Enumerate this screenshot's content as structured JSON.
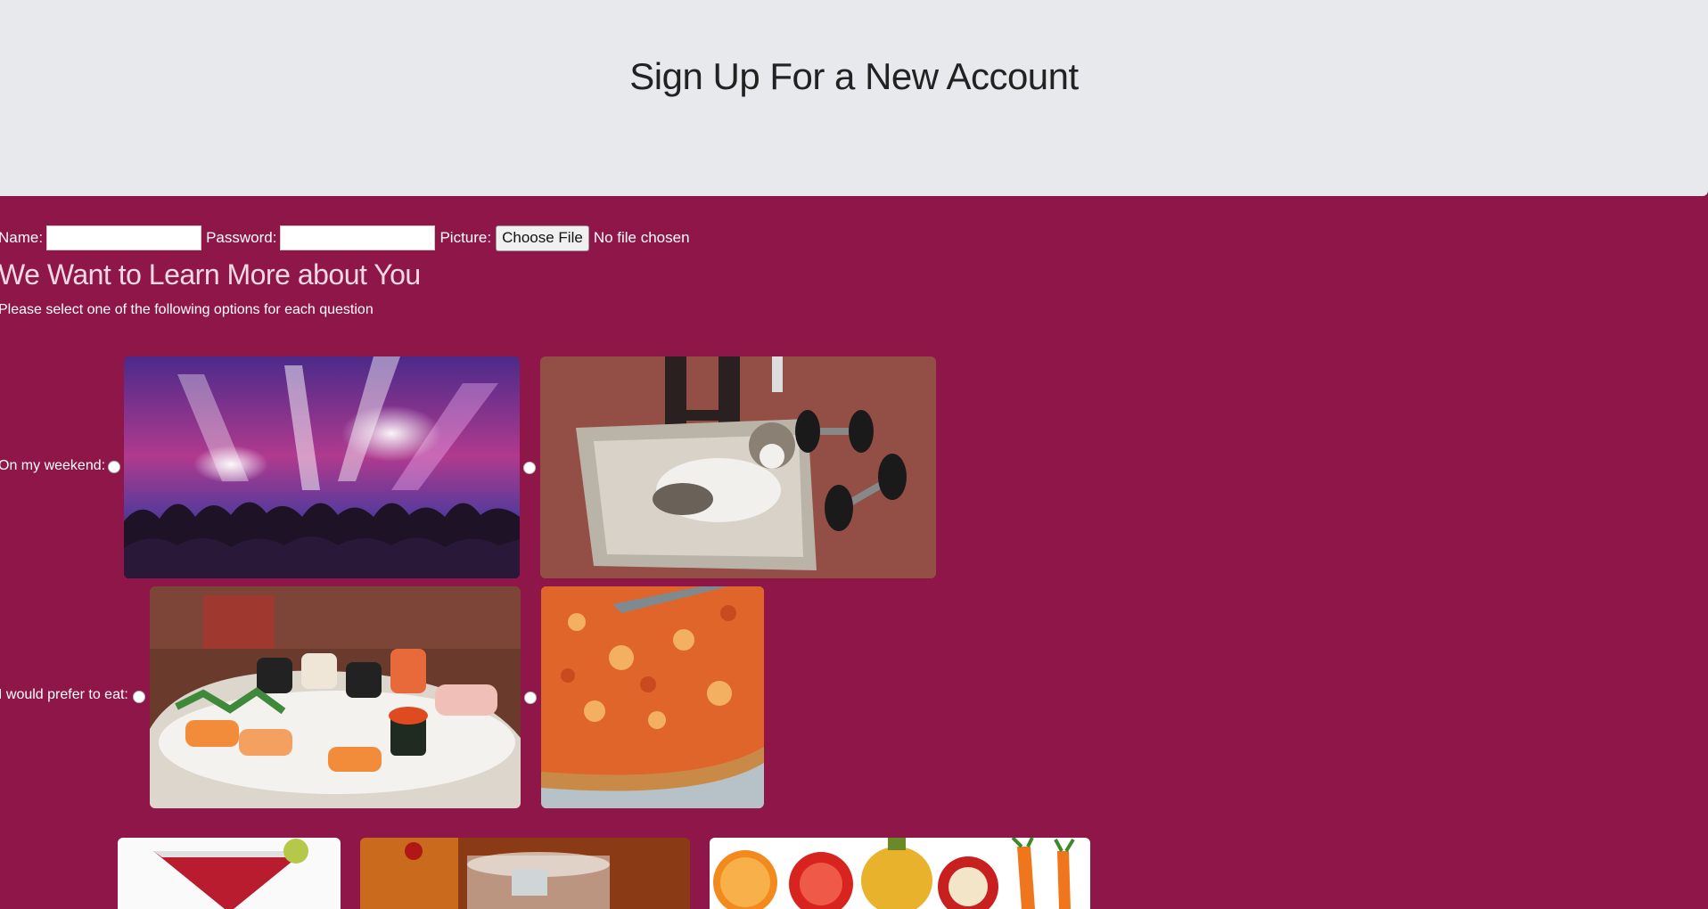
{
  "header": {
    "title": "Sign Up For a New Account"
  },
  "form": {
    "name_label": "Name:",
    "name_value": "",
    "password_label": "Password:",
    "password_value": "",
    "picture_label": "Picture:",
    "choose_file_label": "Choose File",
    "no_file_text": "No file chosen"
  },
  "survey": {
    "heading": "We Want to Learn More about You",
    "instructions": "Please select one of the following options for each question",
    "questions": [
      {
        "label": "On my weekend:",
        "options": [
          {
            "image": "concert-crowd-photo"
          },
          {
            "image": "cat-in-basket-with-dumbbells-photo"
          }
        ]
      },
      {
        "label": "I would prefer to eat:",
        "options": [
          {
            "image": "sushi-platter-photo"
          },
          {
            "image": "pizza-photo"
          }
        ]
      },
      {
        "label": "",
        "options": [
          {
            "image": "cocktail-photo"
          },
          {
            "image": "whiskey-glasses-photo"
          },
          {
            "image": "fruits-vegetables-photo"
          }
        ]
      }
    ]
  },
  "colors": {
    "page_bg": "#8e1648",
    "header_bg": "#e8e9ec"
  }
}
